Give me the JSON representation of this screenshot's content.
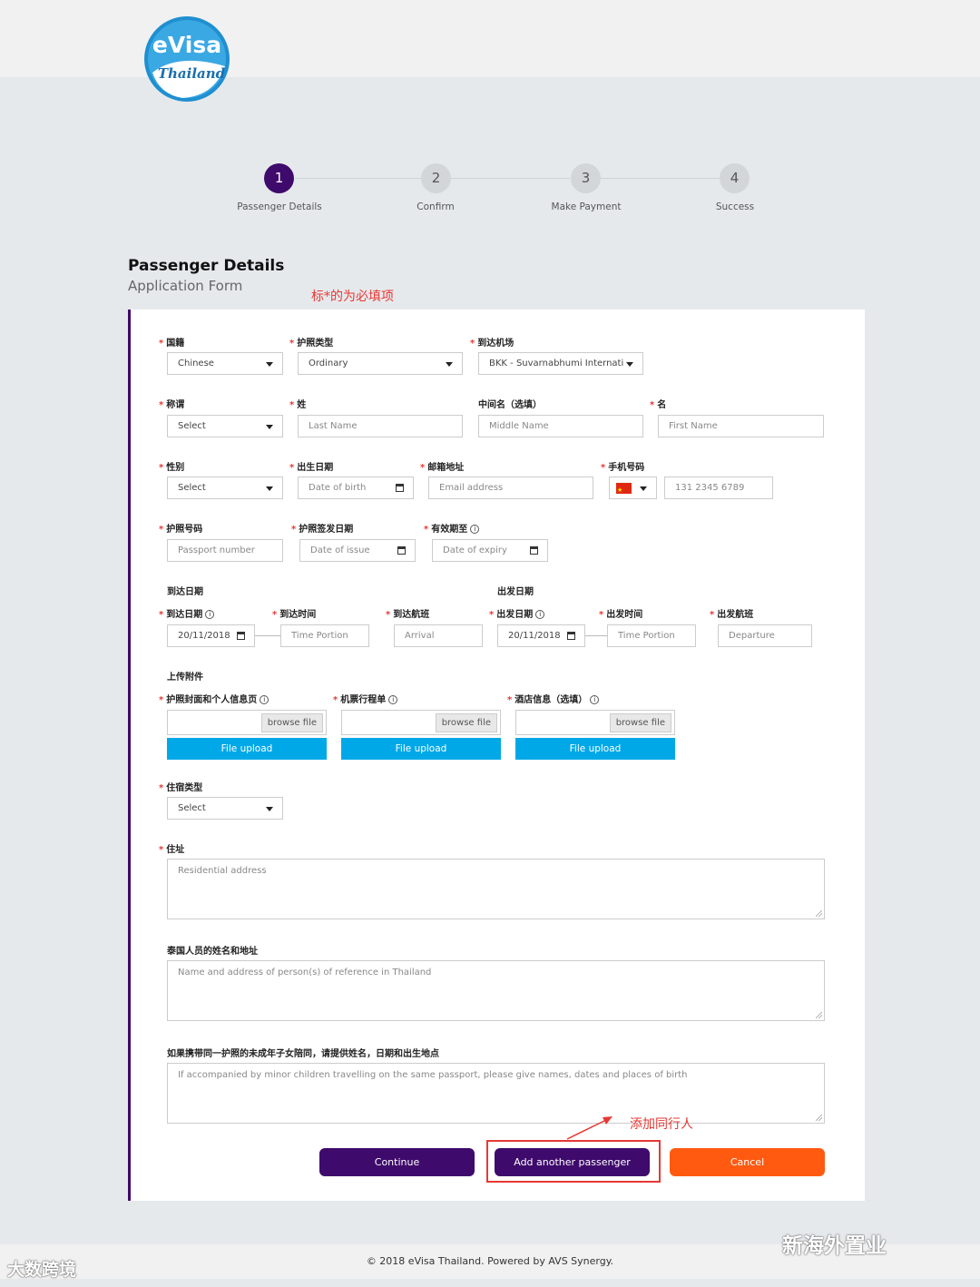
{
  "header": {
    "logo_text": "eVisa Thailand"
  },
  "steps": [
    {
      "number": "1",
      "label": "Passenger Details"
    },
    {
      "number": "2",
      "label": "Confirm"
    },
    {
      "number": "3",
      "label": "Make Payment"
    },
    {
      "number": "4",
      "label": "Success"
    }
  ],
  "page": {
    "title": "Passenger Details",
    "subtitle": "Application Form"
  },
  "annotations": {
    "required_note": "标*的为必填项",
    "add_companion": "添加同行人"
  },
  "form": {
    "nationality": {
      "label": "国籍",
      "value": "Chinese"
    },
    "passport_type": {
      "label": "护照类型",
      "value": "Ordinary"
    },
    "arrival_airport": {
      "label": "到达机场",
      "value": "BKK - Suvarnabhumi Internati"
    },
    "title": {
      "label": "称谓",
      "value": "Select"
    },
    "last_name": {
      "label": "姓",
      "placeholder": "Last Name"
    },
    "middle_name": {
      "label": "中间名（选填）",
      "placeholder": "Middle Name"
    },
    "first_name": {
      "label": "名",
      "placeholder": "First Name"
    },
    "gender": {
      "label": "性别",
      "value": "Select"
    },
    "dob": {
      "label": "出生日期",
      "placeholder": "Date of birth"
    },
    "email": {
      "label": "邮箱地址",
      "placeholder": "Email address"
    },
    "phone": {
      "label": "手机号码",
      "placeholder": "131 2345 6789"
    },
    "passport_number": {
      "label": "护照号码",
      "placeholder": "Passport number"
    },
    "issue_date": {
      "label": "护照签发日期",
      "placeholder": "Date of issue"
    },
    "expiry_date": {
      "label": "有效期至",
      "placeholder": "Date of expiry"
    },
    "arrival_section": "到达日期",
    "departure_section": "出发日期",
    "arrival_date": {
      "label": "到达日期",
      "value": "20/11/2018"
    },
    "arrival_time": {
      "label": "到达时间",
      "placeholder": "Time Portion"
    },
    "arrival_flight": {
      "label": "到达航班",
      "placeholder": "Arrival"
    },
    "departure_date": {
      "label": "出发日期",
      "value": "20/11/2018"
    },
    "departure_time": {
      "label": "出发时间",
      "placeholder": "Time Portion"
    },
    "departure_flight": {
      "label": "出发航班",
      "placeholder": "Departure"
    },
    "attachments_section": "上传附件",
    "attachments": [
      {
        "label": "护照封面和个人信息页",
        "browse": "browse file",
        "upload": "File upload"
      },
      {
        "label": "机票行程单",
        "browse": "browse file",
        "upload": "File upload"
      },
      {
        "label": "酒店信息（选填）",
        "browse": "browse file",
        "upload": "File upload"
      }
    ],
    "accommodation_type": {
      "label": "住宿类型",
      "value": "Select"
    },
    "address": {
      "label": "住址",
      "placeholder": "Residential address"
    },
    "reference": {
      "label": "泰国人员的姓名和地址",
      "placeholder": "Name and address of person(s) of reference in Thailand"
    },
    "minors": {
      "label": "如果携带同一护照的未成年子女陪同，请提供姓名，日期和出生地点",
      "placeholder": "If accompanied by minor children travelling on the same passport, please give names, dates and places of birth"
    }
  },
  "buttons": {
    "continue": "Continue",
    "add_passenger": "Add another passenger",
    "cancel": "Cancel"
  },
  "footer": {
    "text": "© 2018 eVisa Thailand. Powered by AVS Synergy."
  },
  "watermarks": {
    "left": "大数跨境",
    "right": "新海外置业"
  },
  "colors": {
    "primary": "#3e0a6b",
    "accent": "#00a8e8",
    "cancel": "#ff5a10",
    "required": "#e53935"
  }
}
